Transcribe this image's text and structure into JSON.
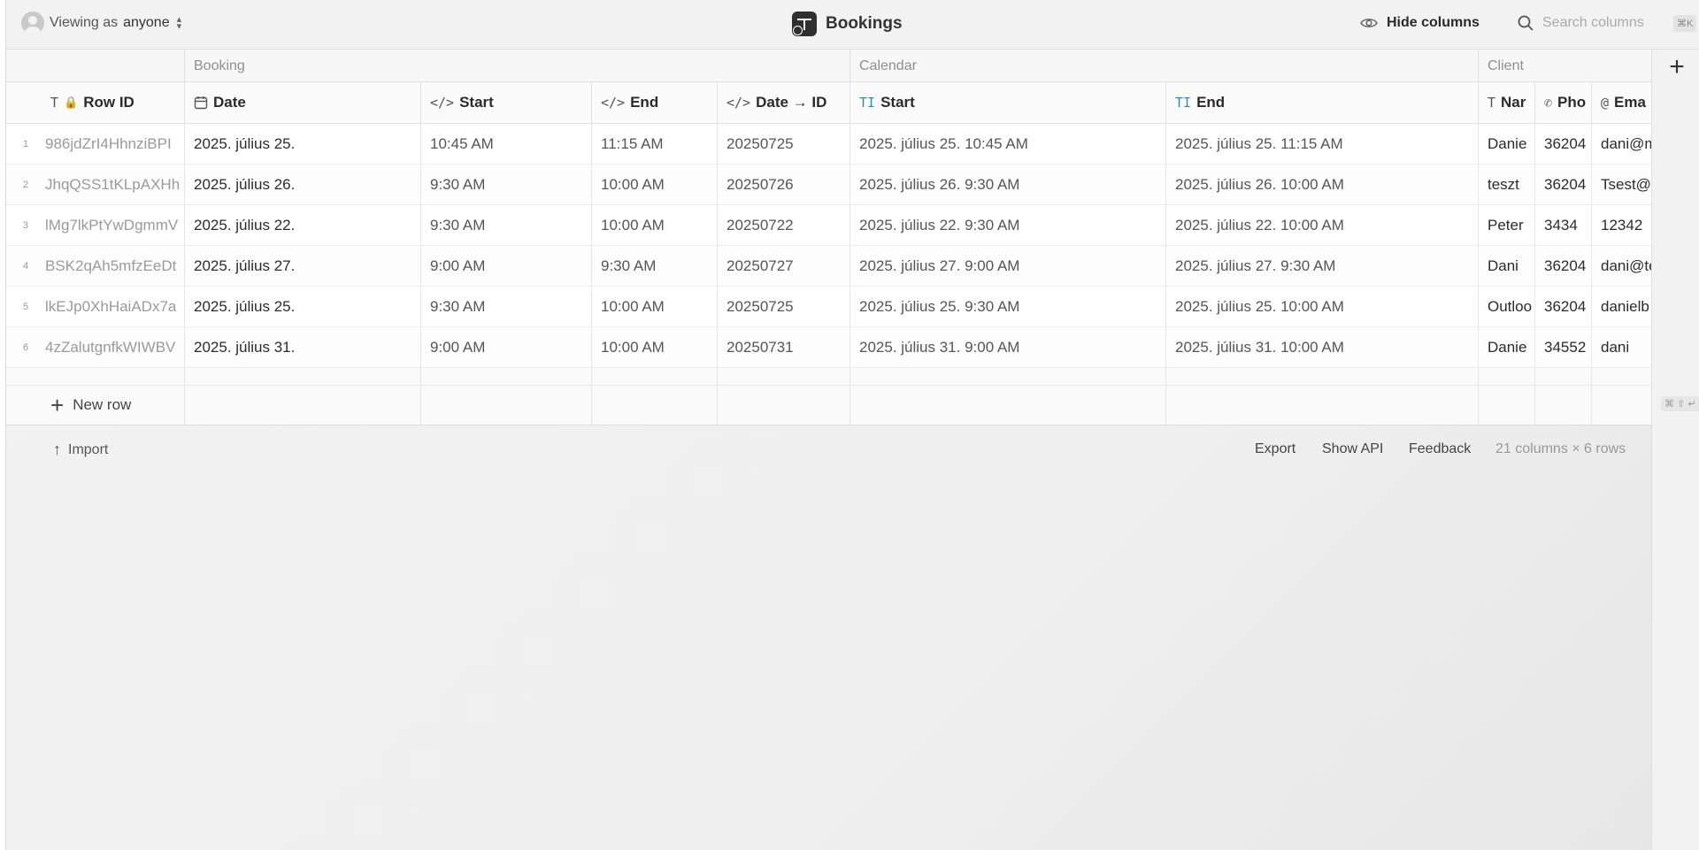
{
  "header": {
    "viewing_prefix": "Viewing as",
    "viewing_who": "anyone",
    "title": "Bookings",
    "hide_columns": "Hide columns",
    "search_placeholder": "Search columns",
    "search_shortcut": "⌘K"
  },
  "groups": [
    {
      "label": ""
    },
    {
      "label": "Booking"
    },
    {
      "label": "Calendar"
    },
    {
      "label": "Client"
    }
  ],
  "columns": [
    {
      "label": "Row ID",
      "icon": "text-icon"
    },
    {
      "label": "Date",
      "icon": "calendar-icon"
    },
    {
      "label": "Start",
      "icon": "code-icon"
    },
    {
      "label": "End",
      "icon": "code-icon"
    },
    {
      "label": "Date → ID",
      "icon": "code-icon"
    },
    {
      "label": "Start",
      "icon": "text-cursor-icon"
    },
    {
      "label": "End",
      "icon": "text-cursor-icon"
    },
    {
      "label": "Nar",
      "icon": "text-icon"
    },
    {
      "label": "Pho",
      "icon": "phone-icon"
    },
    {
      "label": "Ema",
      "icon": "at-icon"
    }
  ],
  "rows": [
    {
      "num": "1",
      "id": "986jdZrI4HhnziBPI",
      "date": "2025. július 25.",
      "start": "10:45 AM",
      "end": "11:15 AM",
      "date_id": "20250725",
      "cal_start": "2025. július 25. 10:45 AM",
      "cal_end": "2025. július 25. 11:15 AM",
      "name": "Danie",
      "phone": "36204",
      "email": "dani@m"
    },
    {
      "num": "2",
      "id": "JhqQSS1tKLpAXHh",
      "date": "2025. július 26.",
      "start": "9:30 AM",
      "end": "10:00 AM",
      "date_id": "20250726",
      "cal_start": "2025. július 26. 9:30 AM",
      "cal_end": "2025. július 26. 10:00 AM",
      "name": "teszt",
      "phone": "36204",
      "email": "Tsest@"
    },
    {
      "num": "3",
      "id": "lMg7lkPtYwDgmmV",
      "date": "2025. július 22.",
      "start": "9:30 AM",
      "end": "10:00 AM",
      "date_id": "20250722",
      "cal_start": "2025. július 22. 9:30 AM",
      "cal_end": "2025. július 22. 10:00 AM",
      "name": "Peter",
      "phone": "3434",
      "email": "12342"
    },
    {
      "num": "4",
      "id": "BSK2qAh5mfzEeDt",
      "date": "2025. július 27.",
      "start": "9:00 AM",
      "end": "9:30 AM",
      "date_id": "20250727",
      "cal_start": "2025. július 27. 9:00 AM",
      "cal_end": "2025. július 27. 9:30 AM",
      "name": "Dani",
      "phone": "36204",
      "email": "dani@te"
    },
    {
      "num": "5",
      "id": "lkEJp0XhHaiADx7a",
      "date": "2025. július 25.",
      "start": "9:30 AM",
      "end": "10:00 AM",
      "date_id": "20250725",
      "cal_start": "2025. július 25. 9:30 AM",
      "cal_end": "2025. július 25. 10:00 AM",
      "name": "Outloo",
      "phone": "36204",
      "email": "danielb"
    },
    {
      "num": "6",
      "id": "4zZalutgnfkWIWBV",
      "date": "2025. július 31.",
      "start": "9:00 AM",
      "end": "10:00 AM",
      "date_id": "20250731",
      "cal_start": "2025. július 31. 9:00 AM",
      "cal_end": "2025. július 31. 10:00 AM",
      "name": "Danie",
      "phone": "34552",
      "email": "dani"
    }
  ],
  "new_row_label": "New row",
  "rail_shortcut": "⌘ ⇧ ↵",
  "footer": {
    "import": "Import",
    "export": "Export",
    "show_api": "Show API",
    "feedback": "Feedback",
    "count": "21 columns × 6 rows"
  }
}
